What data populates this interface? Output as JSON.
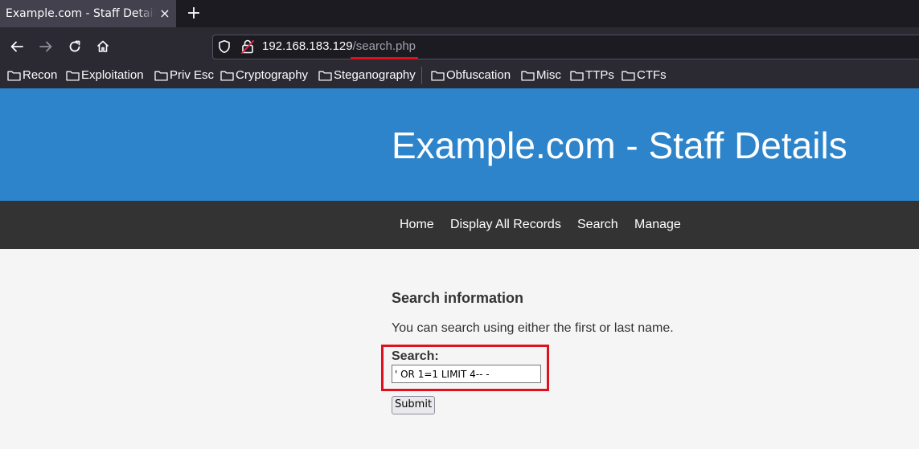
{
  "browser": {
    "tab": {
      "title": "Example.com - Staff Details - Mozilla Firefox",
      "close_label": "×"
    },
    "new_tab_label": "+",
    "url": {
      "host": "192.168.183.129",
      "path": "/search.php"
    },
    "bookmarks": [
      {
        "label": "Recon"
      },
      {
        "label": "Exploitation"
      },
      {
        "label": "Priv Esc"
      },
      {
        "label": "Cryptography"
      },
      {
        "label": "Steganography"
      },
      {
        "label": "Obfuscation"
      },
      {
        "label": "Misc"
      },
      {
        "label": "TTPs"
      },
      {
        "label": "CTFs"
      }
    ]
  },
  "page": {
    "header_title": "Example.com - Staff Details",
    "nav": [
      {
        "label": "Home"
      },
      {
        "label": "Display All Records"
      },
      {
        "label": "Search"
      },
      {
        "label": "Manage"
      }
    ],
    "content": {
      "heading": "Search information",
      "description": "You can search using either the first or last name.",
      "search_label": "Search:",
      "search_value": "' OR 1=1 LIMIT 4-- -",
      "submit_label": "Submit"
    }
  },
  "colors": {
    "header_bg": "#2d84cb",
    "menu_bg": "#333333",
    "annotation_red": "#e0101e"
  }
}
